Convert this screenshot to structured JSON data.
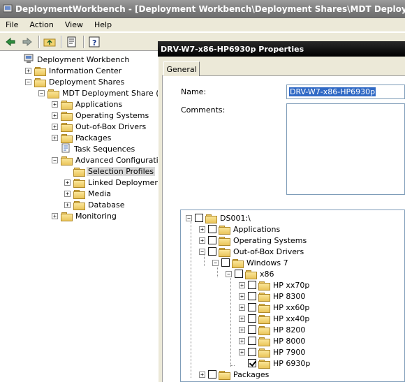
{
  "window": {
    "title": "DeploymentWorkbench - [Deployment Workbench\\Deployment Shares\\MDT Deployment Shar"
  },
  "menu": [
    "File",
    "Action",
    "View",
    "Help"
  ],
  "toolbar": {
    "icons": [
      "back-arrow-icon",
      "forward-arrow-icon",
      "up-folder-icon",
      "properties-icon",
      "help-icon"
    ]
  },
  "nav_tree": {
    "root": "Deployment Workbench",
    "info_center": "Information Center",
    "deployment_shares": "Deployment Shares",
    "share": "MDT Deployment Share (d:\\",
    "applications": "Applications",
    "operating_systems": "Operating Systems",
    "drivers": "Out-of-Box Drivers",
    "packages": "Packages",
    "task_sequences": "Task Sequences",
    "advanced": "Advanced Configuration",
    "selection_profiles": "Selection Profiles",
    "linked": "Linked Deployment S",
    "media": "Media",
    "database": "Database",
    "monitoring": "Monitoring"
  },
  "dialog": {
    "title": "DRV-W7-x86-HP6930p Properties",
    "tab": "General",
    "name_label": "Name:",
    "name_value": "DRV-W7-x86-HP6930p",
    "comments_label": "Comments:",
    "comments_value": ""
  },
  "profile_tree": {
    "root": "DS001:\\",
    "applications": "Applications",
    "operating_systems": "Operating Systems",
    "drivers": "Out-of-Box Drivers",
    "windows7": "Windows 7",
    "x86": "x86",
    "models": [
      {
        "label": "HP xx70p",
        "checked": false
      },
      {
        "label": "HP 8300",
        "checked": false
      },
      {
        "label": "HP xx60p",
        "checked": false
      },
      {
        "label": "HP xx40p",
        "checked": false
      },
      {
        "label": "HP 8200",
        "checked": false
      },
      {
        "label": "HP 8000",
        "checked": false
      },
      {
        "label": "HP 7900",
        "checked": false
      },
      {
        "label": "HP 6930p",
        "checked": true
      }
    ],
    "packages": "Packages"
  },
  "colors": {
    "dialog_title_bg": "#000000",
    "selection_highlight": "#316ac5",
    "window_title_bg": "#7a7a7a"
  }
}
